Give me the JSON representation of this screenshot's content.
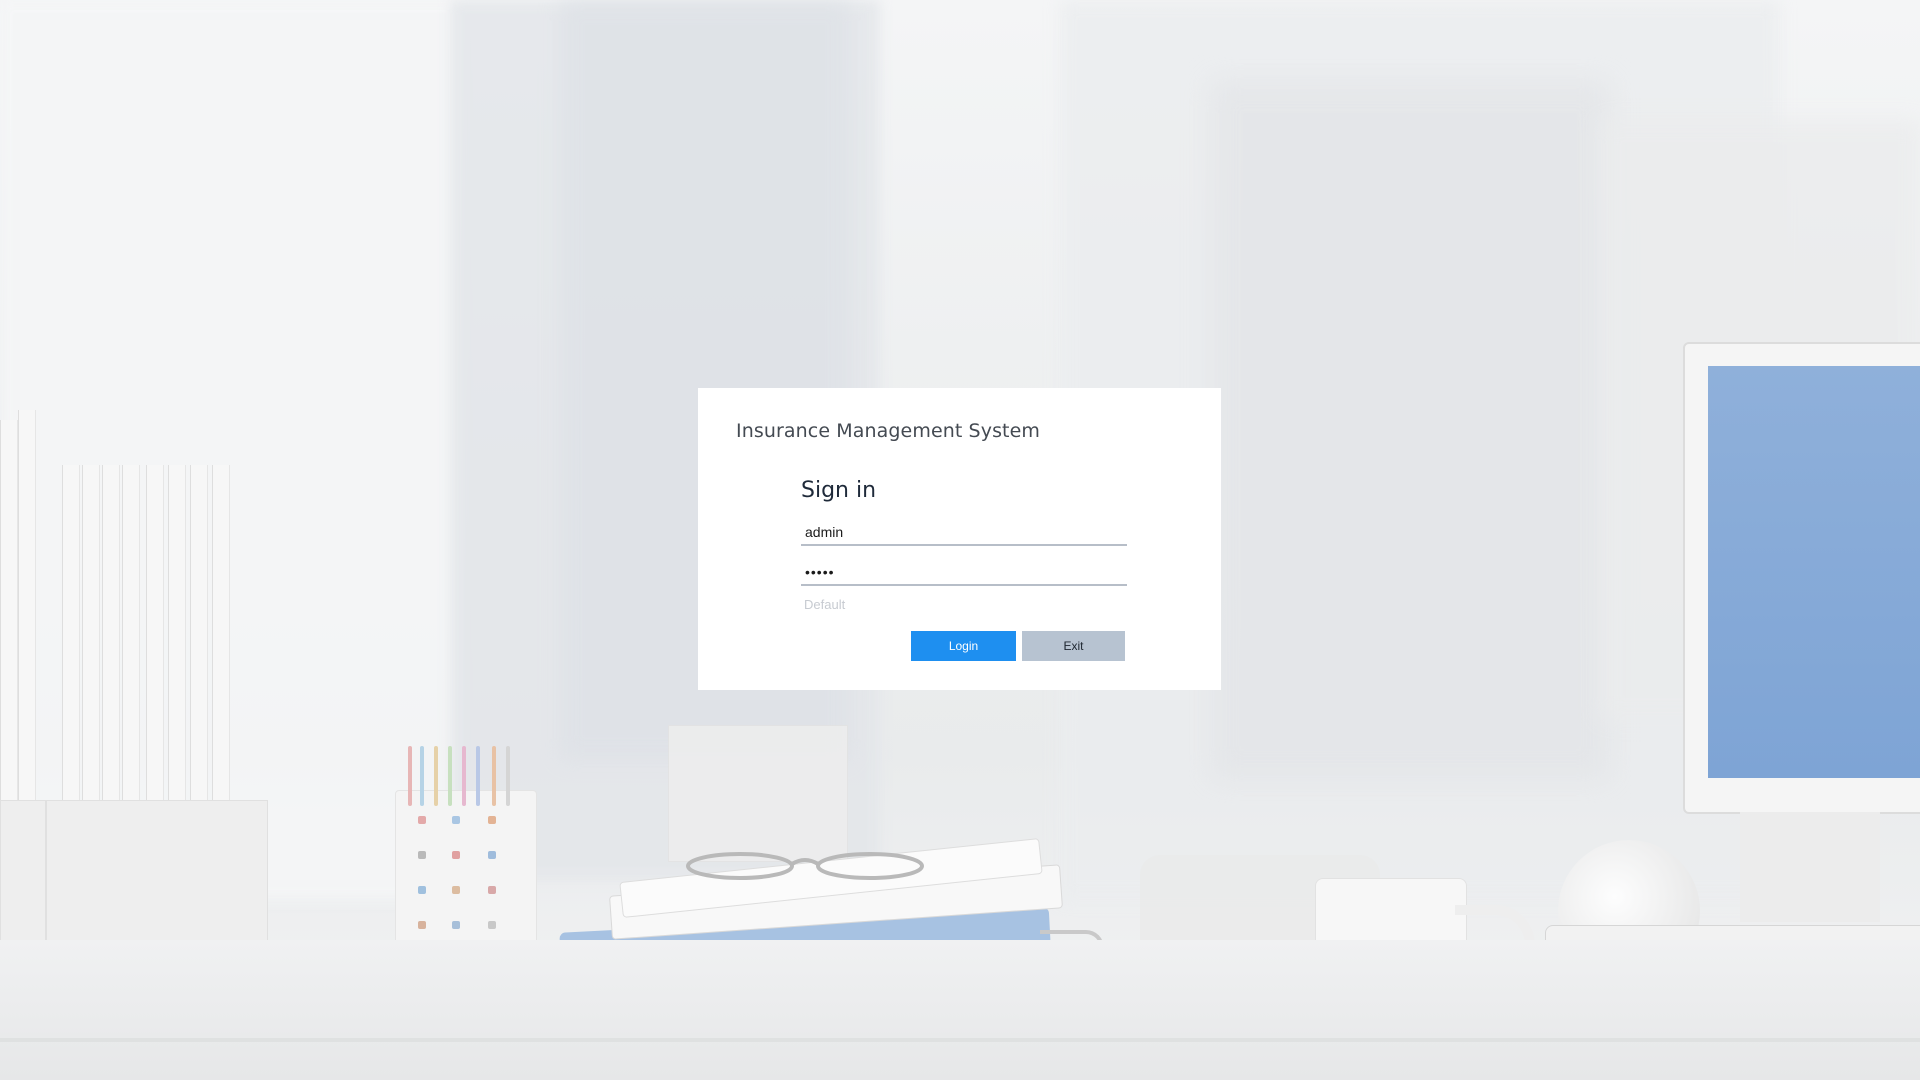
{
  "app": {
    "title": "Insurance Management System"
  },
  "login_form": {
    "heading": "Sign in",
    "username_value": "admin",
    "password_value": "•••••",
    "hint_text": "Default",
    "login_label": "Login",
    "exit_label": "Exit"
  },
  "colors": {
    "login_button": "#1e8ff0",
    "exit_button": "#b7c3d1",
    "card_background": "#ffffff",
    "monitor_screen": "#7ea4d5"
  }
}
